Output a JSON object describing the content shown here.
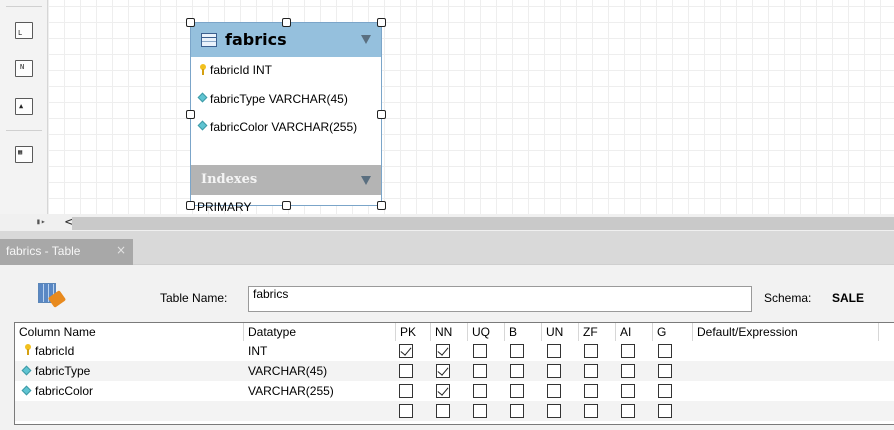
{
  "diagram": {
    "entity": {
      "title": "fabrics",
      "columns": [
        {
          "text": "fabricId INT",
          "icon": "primary-key-icon"
        },
        {
          "text": "fabricType VARCHAR(45)",
          "icon": "column-diamond-icon"
        },
        {
          "text": "fabricColor VARCHAR(255)",
          "icon": "column-diamond-icon"
        }
      ],
      "indexes_label": "Indexes",
      "indexes": [
        "PRIMARY"
      ]
    },
    "scroll_left_glyph": "<"
  },
  "tab": {
    "label": "fabrics - Table",
    "close_glyph": "×"
  },
  "editor": {
    "table_name_label": "Table Name:",
    "table_name_value": "fabrics",
    "schema_label": "Schema:",
    "schema_value": "SALE",
    "headers": [
      "Column Name",
      "Datatype",
      "PK",
      "NN",
      "UQ",
      "B",
      "UN",
      "ZF",
      "AI",
      "G",
      "Default/Expression"
    ],
    "rows": [
      {
        "name": "fabricId",
        "datatype": "INT",
        "icon": "primary-key-icon",
        "flags": [
          true,
          true,
          false,
          false,
          false,
          false,
          false,
          false
        ]
      },
      {
        "name": "fabricType",
        "datatype": "VARCHAR(45)",
        "icon": "column-diamond-icon",
        "flags": [
          false,
          true,
          false,
          false,
          false,
          false,
          false,
          false
        ]
      },
      {
        "name": "fabricColor",
        "datatype": "VARCHAR(255)",
        "icon": "column-diamond-icon",
        "flags": [
          false,
          true,
          false,
          false,
          false,
          false,
          false,
          false
        ]
      },
      {
        "name": "",
        "datatype": "",
        "icon": "",
        "flags": [
          false,
          false,
          false,
          false,
          false,
          false,
          false,
          false
        ]
      }
    ]
  }
}
